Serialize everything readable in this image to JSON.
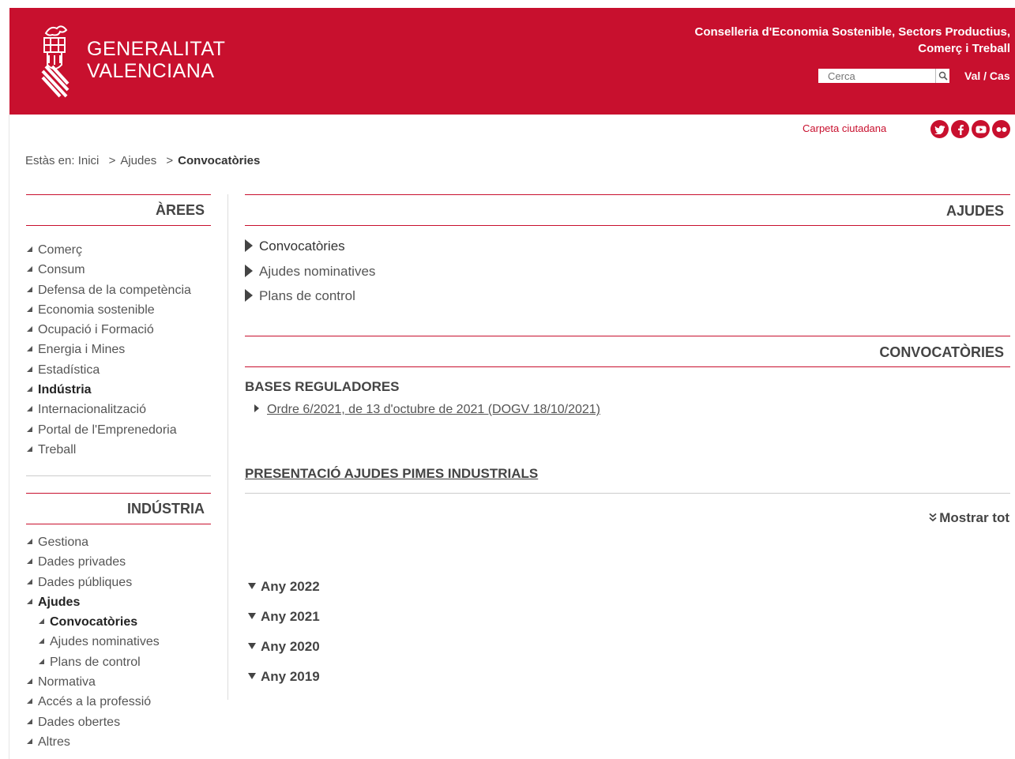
{
  "header": {
    "logo_line1": "GENERALITAT",
    "logo_line2": "VALENCIANA",
    "department_line1": "Conselleria d'Economia Sostenible, Sectors Productius,",
    "department_line2": "Comerç i Treball",
    "search_placeholder": "Cerca",
    "lang_val": "Val",
    "lang_sep": " / ",
    "lang_cas": "Cas",
    "carpeta": "Carpeta ciutadana",
    "social_icons": [
      "twitter-icon",
      "facebook-icon",
      "youtube-icon",
      "flickr-icon"
    ],
    "brand_color": "#c8102e"
  },
  "breadcrumb": {
    "label": "Estàs en:",
    "items": [
      "Inici",
      "Ajudes",
      "Convocatòries"
    ],
    "sep": ">"
  },
  "sidebar": {
    "areas_title": "ÀREES",
    "areas": [
      "Comerç",
      "Consum",
      "Defensa de la competència",
      "Economia sostenible",
      "Ocupació i Formació",
      "Energia i Mines",
      "Estadística",
      "Indústria",
      "Internacionalització",
      "Portal de l'Emprenedoria",
      "Treball"
    ],
    "areas_active": "Indústria",
    "industria_title": "INDÚSTRIA",
    "industria": [
      {
        "label": "Gestiona",
        "level": 0,
        "active": false
      },
      {
        "label": "Dades privades",
        "level": 0,
        "active": false
      },
      {
        "label": "Dades públiques",
        "level": 0,
        "active": false
      },
      {
        "label": "Ajudes",
        "level": 0,
        "active": true
      },
      {
        "label": "Convocatòries",
        "level": 1,
        "active": true
      },
      {
        "label": "Ajudes nominatives",
        "level": 1,
        "active": false
      },
      {
        "label": "Plans de control",
        "level": 1,
        "active": false
      },
      {
        "label": "Normativa",
        "level": 0,
        "active": false
      },
      {
        "label": "Accés a la professió",
        "level": 0,
        "active": false
      },
      {
        "label": "Dades obertes",
        "level": 0,
        "active": false
      },
      {
        "label": "Altres",
        "level": 0,
        "active": false
      }
    ]
  },
  "main": {
    "ajudes_title": "AJUDES",
    "ajudes_items": [
      "Convocatòries",
      "Ajudes nominatives",
      "Plans de control"
    ],
    "convocatories_title": "CONVOCATÒRIES",
    "bases_title": "BASES REGULADORES",
    "ordre_link": "Ordre 6/2021, de 13 d'octubre de 2021 (DOGV 18/10/2021)",
    "presentacio_link": "PRESENTACIÓ AJUDES PIMES INDUSTRIALS",
    "mostrar_tot": "Mostrar tot",
    "years": [
      "Any 2022",
      "Any 2021",
      "Any 2020",
      "Any 2019"
    ]
  }
}
